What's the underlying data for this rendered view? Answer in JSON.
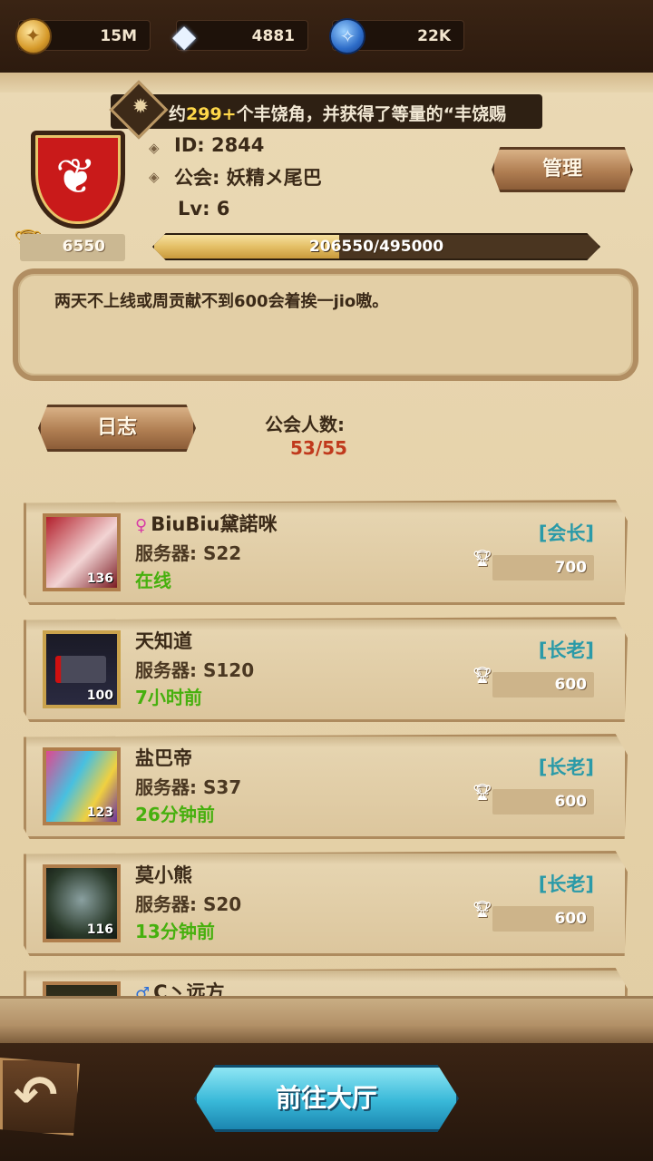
{
  "currency": {
    "gold": "15M",
    "diamond": "4881",
    "scroll": "22K"
  },
  "marquee": {
    "prefix": "约",
    "highlight": "299+",
    "text": "个丰饶角，并获得了等量的“丰饶赐"
  },
  "guild": {
    "id_line": "ID: 2844",
    "name_line": "公会: 妖精メ尾巴",
    "level_line": "Lv: 6",
    "trophies": "6550",
    "exp_text": "206550/495000",
    "exp_current": 206550,
    "exp_max": 495000,
    "notice": "两天不上线或周贡献不到600会着挨一jio嗷。",
    "member_label": "公会人数:",
    "member_count": "53/55"
  },
  "buttons": {
    "manage": "管理",
    "log": "日志",
    "lobby": "前往大厅"
  },
  "members": [
    {
      "gender": "♀",
      "name": "BiuBiu黛諾咪",
      "server": "服务器: S22",
      "status": "在线",
      "rank": "[会长]",
      "contribution": "700",
      "level": "136"
    },
    {
      "gender": "",
      "name": "天知道",
      "server": "服务器: S120",
      "status": "7小时前",
      "rank": "[长老]",
      "contribution": "600",
      "level": "100"
    },
    {
      "gender": "",
      "name": "盐巴帝",
      "server": "服务器: S37",
      "status": "26分钟前",
      "rank": "[长老]",
      "contribution": "600",
      "level": "123"
    },
    {
      "gender": "",
      "name": "莫小熊",
      "server": "服务器: S20",
      "status": "13分钟前",
      "rank": "[长老]",
      "contribution": "600",
      "level": "116"
    },
    {
      "gender": "♂",
      "name": "C丶远方",
      "server": "",
      "status": "",
      "rank": "",
      "contribution": "",
      "level": ""
    }
  ]
}
